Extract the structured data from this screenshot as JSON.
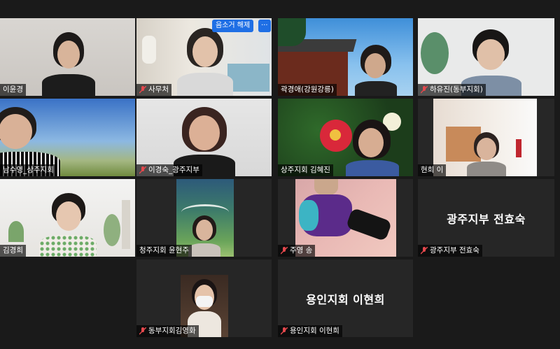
{
  "tiles": [
    {
      "name": "이윤경",
      "muted": false
    },
    {
      "name": "사무처",
      "muted": true,
      "hover_action": "음소거 해제",
      "more": "···"
    },
    {
      "name": "곽경애(강원강릉)",
      "muted": false
    },
    {
      "name": "하유진(동부지회)",
      "muted": true
    },
    {
      "name": "남수영_상주지회",
      "muted": false
    },
    {
      "name": "이경숙_광주지부",
      "muted": true
    },
    {
      "name": "상주지회 김혜진",
      "muted": false
    },
    {
      "name": "현희 이",
      "muted": false,
      "active_speaker": true
    },
    {
      "name": "김경희",
      "muted": false
    },
    {
      "name": "청주지회 윤현주",
      "muted": false
    },
    {
      "name": "주영 송",
      "muted": true
    },
    {
      "name": "광주지부 전효숙",
      "muted": true,
      "video_off_name": "광주지부 전효숙"
    },
    {
      "name": "동부지회김영화",
      "muted": true
    },
    {
      "name": "용인지회 이현희",
      "muted": true,
      "video_off_name": "용인지회 이현희"
    }
  ],
  "colors": {
    "active_border": "#b8e04a",
    "muted_icon": "#e5484d",
    "background": "#1a1a1a"
  }
}
